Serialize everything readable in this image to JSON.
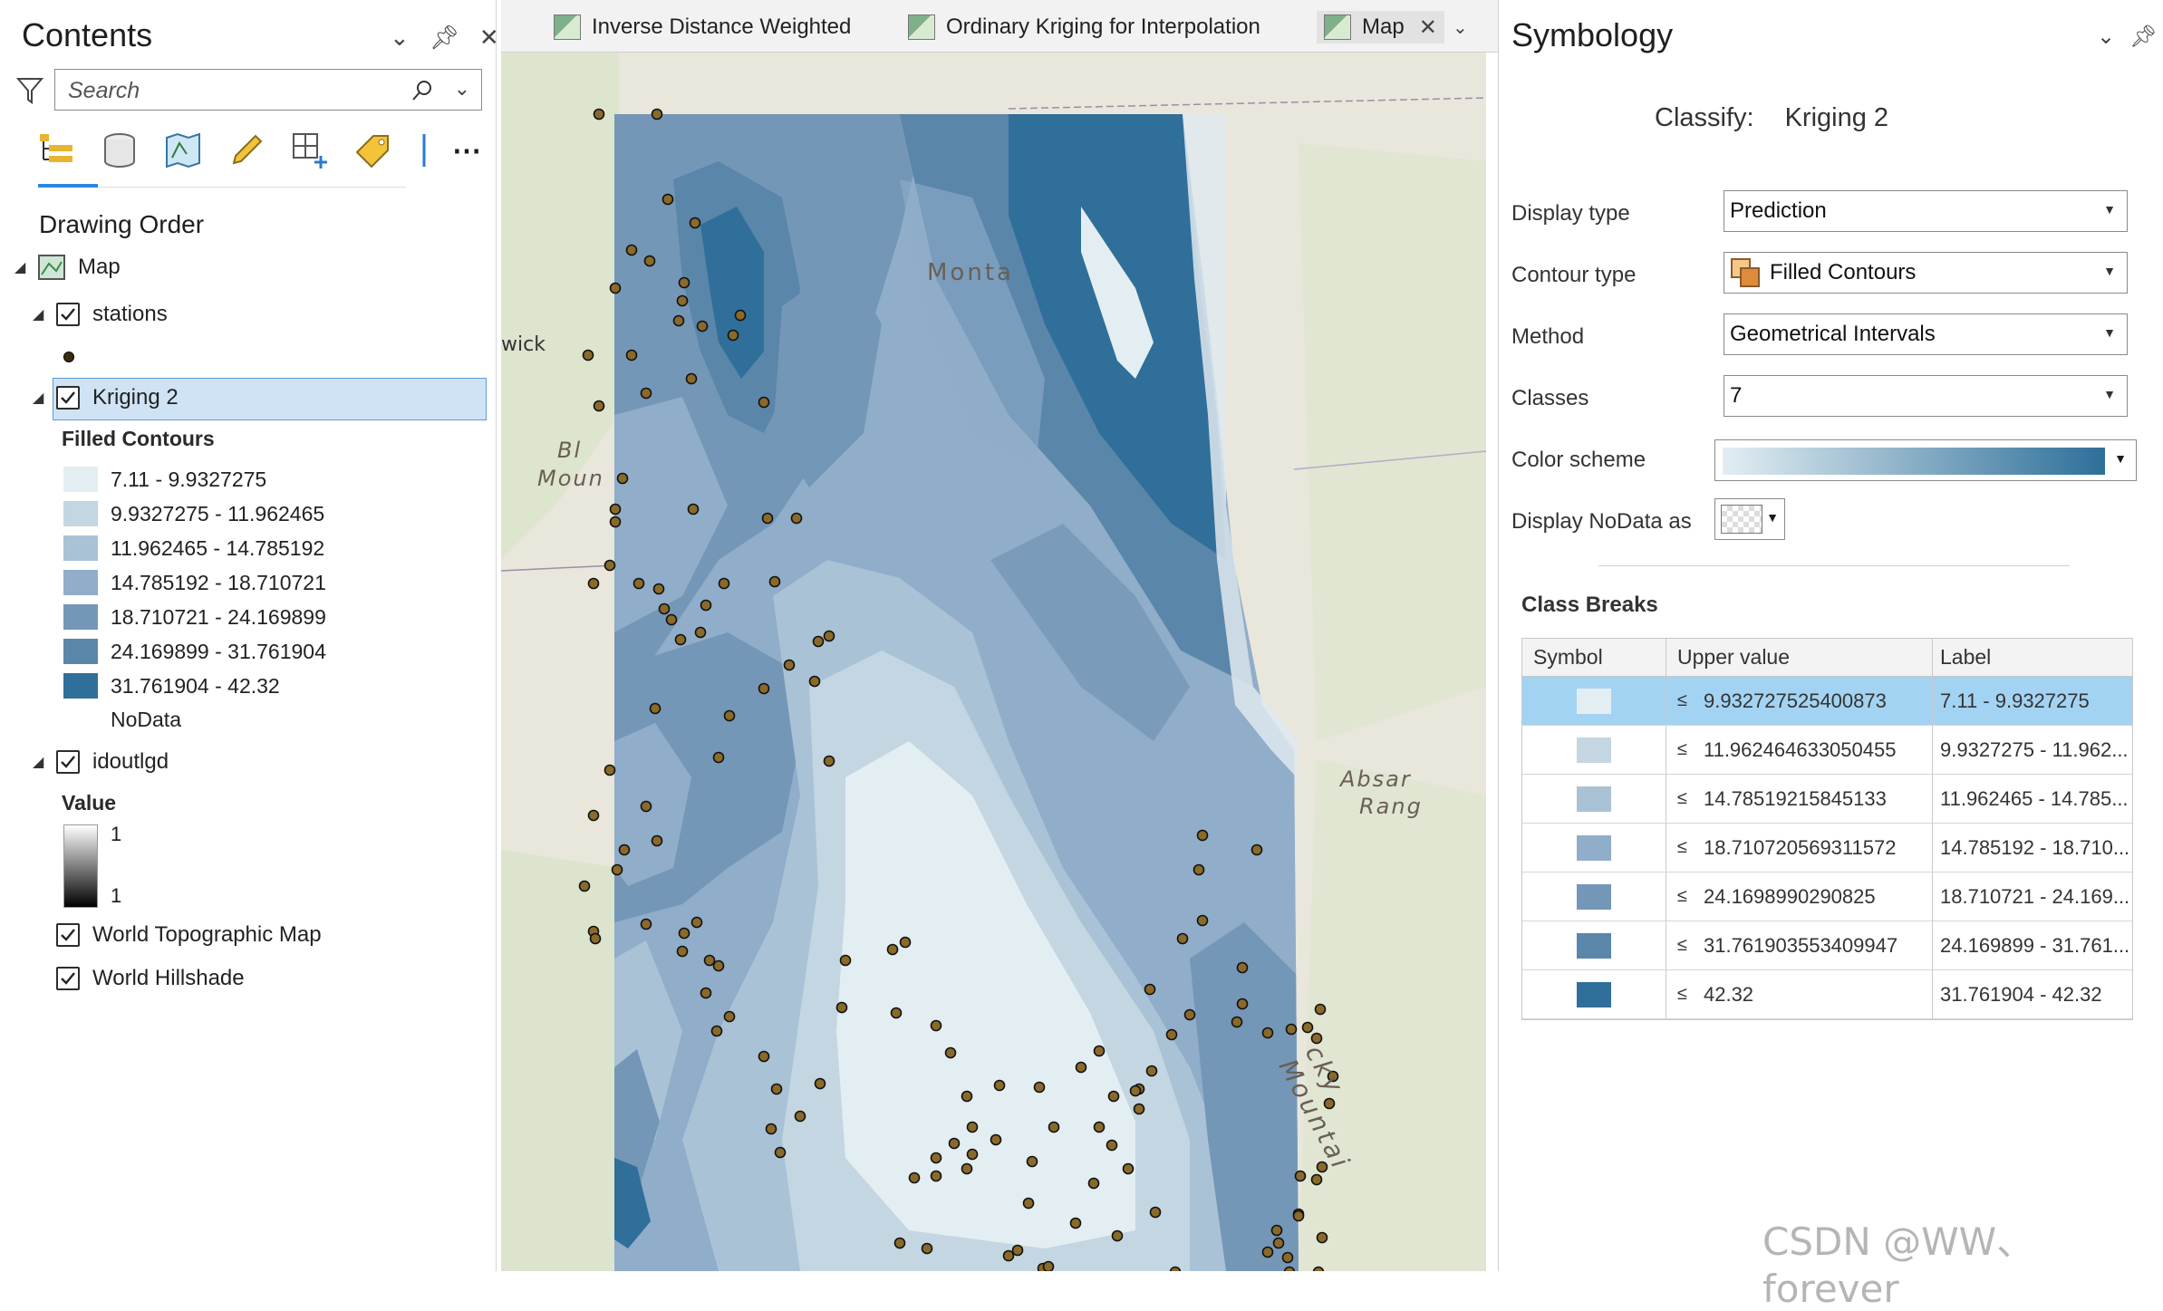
{
  "contents": {
    "title": "Contents",
    "search_placeholder": "Search",
    "drawing_order_label": "Drawing Order",
    "layers": {
      "map": "Map",
      "stations": "stations",
      "kriging": "Kriging 2",
      "kriging_sublabel": "Filled Contours",
      "idoutlgd": "idoutlgd",
      "idoutlgd_sublabel": "Value",
      "ramp_high": "1",
      "ramp_low": "1",
      "topo": "World Topographic Map",
      "hillshade": "World Hillshade"
    },
    "legend": [
      {
        "label": "7.11 - 9.9327275",
        "color": "#e3eef3"
      },
      {
        "label": "9.9327275 - 11.962465",
        "color": "#c4d6e2"
      },
      {
        "label": "11.962465 - 14.785192",
        "color": "#aac2d5"
      },
      {
        "label": "14.785192 - 18.710721",
        "color": "#90adc9"
      },
      {
        "label": "18.710721 - 24.169899",
        "color": "#7497b7"
      },
      {
        "label": "24.169899 - 31.761904",
        "color": "#5a86aa"
      },
      {
        "label": "31.761904 - 42.32",
        "color": "#2f6f9a"
      }
    ],
    "nodata_label": "NoData"
  },
  "tabs": [
    {
      "label": "Inverse Distance Weighted"
    },
    {
      "label": "Ordinary Kriging for Interpolation"
    },
    {
      "label": "Map"
    }
  ],
  "map_labels": {
    "montana": "Monta",
    "wick": "wick",
    "bl": "Bl",
    "moun": "Moun",
    "absar": "Absar",
    "rang": "Rang",
    "rocky": "cky Mountai"
  },
  "symbology": {
    "title": "Symbology",
    "classify_label": "Classify:",
    "classify_value": "Kriging 2",
    "display_type_label": "Display type",
    "display_type_value": "Prediction",
    "contour_type_label": "Contour type",
    "contour_type_value": "Filled Contours",
    "method_label": "Method",
    "method_value": "Geometrical Intervals",
    "classes_label": "Classes",
    "classes_value": "7",
    "color_scheme_label": "Color scheme",
    "nodata_label": "Display NoData as",
    "class_breaks_label": "Class Breaks",
    "table_headers": {
      "symbol": "Symbol",
      "upper": "Upper value",
      "label": "Label"
    },
    "breaks": [
      {
        "upper": "9.932727525400873",
        "label": "7.11 - 9.9327275",
        "color": "#e3eef3"
      },
      {
        "upper": "11.962464633050455",
        "label": "9.9327275 - 11.962...",
        "color": "#c4d6e2"
      },
      {
        "upper": "14.78519215845133",
        "label": "11.962465 - 14.785...",
        "color": "#aac2d5"
      },
      {
        "upper": "18.710720569311572",
        "label": "14.785192 - 18.710...",
        "color": "#90adc9"
      },
      {
        "upper": "24.1698990290825",
        "label": "18.710721 - 24.169...",
        "color": "#7497b7"
      },
      {
        "upper": "31.761903553409947",
        "label": "24.169899 - 31.761...",
        "color": "#5a86aa"
      },
      {
        "upper": "42.32",
        "label": "31.761904 - 42.32",
        "color": "#2f6f9a"
      }
    ],
    "le_symbol": "≤"
  },
  "watermark": "CSDN @WW、forever"
}
